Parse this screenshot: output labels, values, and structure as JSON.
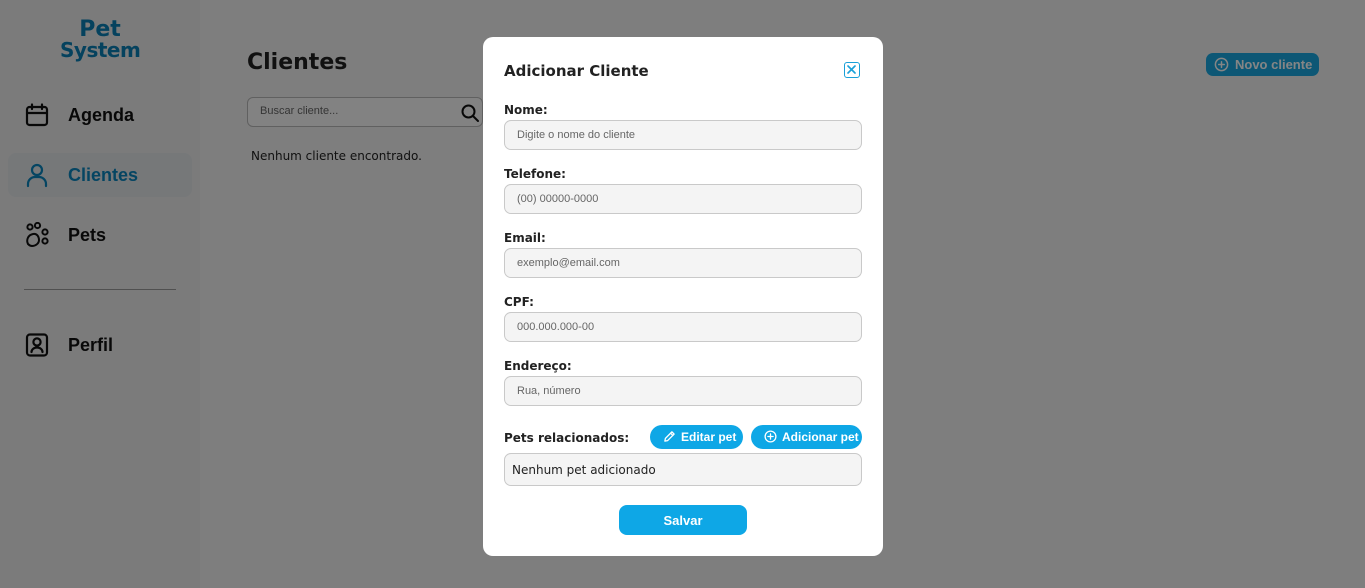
{
  "app": {
    "logo_line1": "Pet",
    "logo_line2": "System",
    "brand_color": "#0a7fb5",
    "accent_color": "#0ea7e6"
  },
  "sidebar": {
    "items": [
      {
        "label": "Agenda",
        "icon": "calendar-icon",
        "active": false
      },
      {
        "label": "Clientes",
        "icon": "user-icon",
        "active": true
      },
      {
        "label": "Pets",
        "icon": "paw-icon",
        "active": false
      },
      {
        "label": "Perfil",
        "icon": "profile-icon",
        "active": false
      }
    ]
  },
  "main": {
    "title": "Clientes",
    "search_placeholder": "Buscar cliente...",
    "empty_message": "Nenhum cliente encontrado.",
    "new_client_label": "Novo cliente"
  },
  "modal": {
    "title": "Adicionar Cliente",
    "fields": [
      {
        "label": "Nome:",
        "placeholder": "Digite o nome do cliente",
        "value": ""
      },
      {
        "label": "Telefone:",
        "placeholder": "(00) 00000-0000",
        "value": ""
      },
      {
        "label": "Email:",
        "placeholder": "exemplo@email.com",
        "value": ""
      },
      {
        "label": "CPF:",
        "placeholder": "000.000.000-00",
        "value": ""
      },
      {
        "label": "Endereço:",
        "placeholder": "Rua, número",
        "value": ""
      }
    ],
    "pets_label": "Pets relacionados:",
    "edit_pet_label": "Editar pet",
    "add_pet_label": "Adicionar pet",
    "pets_empty": "Nenhum pet adicionado",
    "save_label": "Salvar"
  }
}
